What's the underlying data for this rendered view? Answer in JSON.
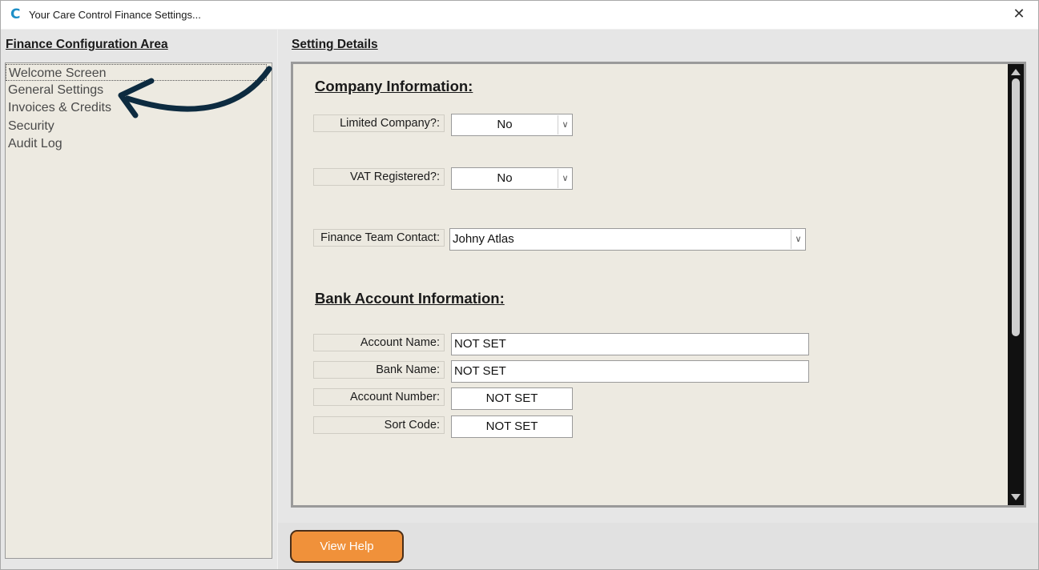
{
  "window": {
    "title": "Your Care Control Finance Settings...",
    "app_icon_glyph": "C",
    "close_glyph": "✕"
  },
  "left": {
    "heading": "Finance Configuration Area",
    "items": [
      {
        "label": "Welcome Screen",
        "selected": true
      },
      {
        "label": "General Settings",
        "selected": false
      },
      {
        "label": "Invoices & Credits",
        "selected": false
      },
      {
        "label": "Security",
        "selected": false
      },
      {
        "label": "Audit Log",
        "selected": false
      }
    ],
    "annotation_arrow_color": "#0d2b40"
  },
  "right": {
    "heading": "Setting Details",
    "company": {
      "title": "Company Information:",
      "limited_label": "Limited Company?:",
      "limited_value": "No",
      "vat_label": "VAT Registered?:",
      "vat_value": "No",
      "contact_label": "Finance Team Contact:",
      "contact_value": "Johny Atlas"
    },
    "bank": {
      "title": "Bank Account Information:",
      "account_name_label": "Account Name:",
      "account_name_value": "NOT SET",
      "bank_name_label": "Bank Name:",
      "bank_name_value": "NOT SET",
      "account_number_label": "Account Number:",
      "account_number_value": "NOT SET",
      "sort_code_label": "Sort Code:",
      "sort_code_value": "NOT SET"
    },
    "help_button": "View Help",
    "dropdown_glyph": "∨"
  },
  "colors": {
    "accent_button": "#f0913a",
    "form_background": "#edeae1",
    "scrollbar": "#111111"
  }
}
